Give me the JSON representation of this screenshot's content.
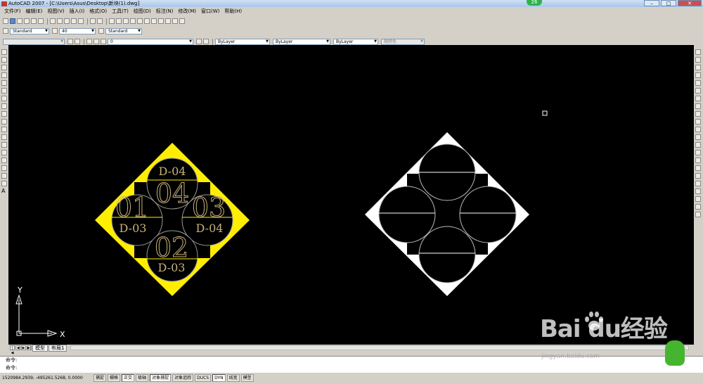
{
  "window": {
    "title": "AutoCAD 2007 - [C:\\Users\\Asus\\Desktop\\新块(1).dwg]",
    "badge": "26"
  },
  "menu": [
    "文件(F)",
    "编辑(E)",
    "视图(V)",
    "插入(I)",
    "格式(O)",
    "工具(T)",
    "绘图(D)",
    "标注(N)",
    "修改(M)",
    "窗口(W)",
    "帮助(H)"
  ],
  "styles": {
    "text_style": "Standard",
    "dim_scale": "40",
    "dim_style": "Standard"
  },
  "layers": {
    "current_layer": "0",
    "color": "ByLayer",
    "linetype": "ByLayer",
    "lineweight": "ByLayer",
    "plotstyle": "随颜色"
  },
  "drawing": {
    "left_block": {
      "labels": [
        {
          "big": "04",
          "small": "D-04"
        },
        {
          "big": "01",
          "small": "D-03"
        },
        {
          "big": "03",
          "small": "D-04"
        },
        {
          "big": "02",
          "small": "D-03"
        }
      ]
    },
    "ucs": {
      "x": "X",
      "y": "Y"
    }
  },
  "tabs": [
    "模型",
    "布局1"
  ],
  "command": {
    "line1": "命令:",
    "line2": "命令:"
  },
  "status": {
    "coords": "1520984.2939, -495261.5268, 0.0000",
    "buttons": [
      "捕捉",
      "栅格",
      "正交",
      "极轴",
      "对象捕捉",
      "对象追踪",
      "DUCS",
      "DYN",
      "线宽",
      "模型"
    ]
  },
  "watermark": {
    "logo": "Bai   du经验",
    "url": "jingyan.baidu.com"
  },
  "colors": {
    "canvas": "#000000",
    "highlight": "#ffee00",
    "text_gold": "#c9b27a"
  }
}
